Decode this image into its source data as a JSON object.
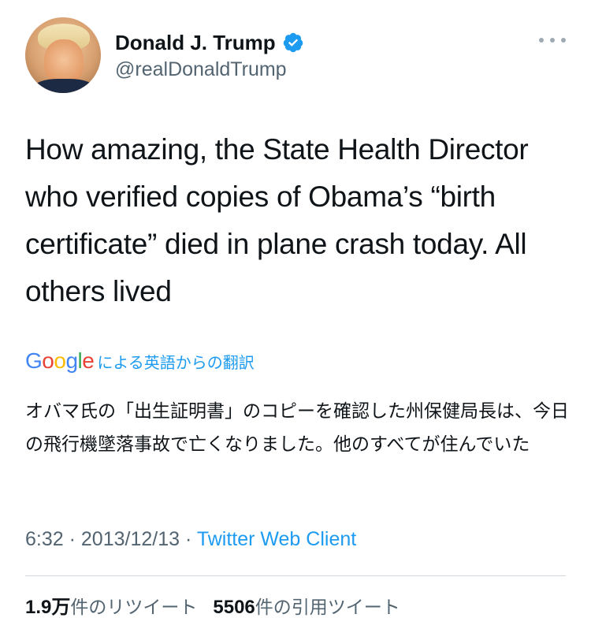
{
  "user": {
    "display_name": "Donald J. Trump",
    "handle": "@realDonaldTrump",
    "verified": true,
    "verified_color": "#1d9bf0"
  },
  "tweet": {
    "text": "How amazing, the State Health Director who verified copies of Obama’s “birth certificate” died in plane crash today. All others lived"
  },
  "translation": {
    "provider_logo": [
      "G",
      "o",
      "o",
      "g",
      "l",
      "e"
    ],
    "label": "による英語からの翻訳",
    "text": "オバマ氏の「出生証明書」のコピーを確認した州保健局長は、今日の飛行機墜落事故で亡くなりました。他のすべてが住んでいた"
  },
  "meta": {
    "time": "6:32",
    "separator": "·",
    "date": "2013/12/13",
    "source": "Twitter Web Client"
  },
  "stats": {
    "retweets_count": "1.9万",
    "retweets_label": "件のリツイート",
    "quotes_count": "5506",
    "quotes_label": "件の引用ツイート"
  },
  "icons": {
    "more": "more-horizontal-icon",
    "verified": "verified-badge-icon"
  }
}
